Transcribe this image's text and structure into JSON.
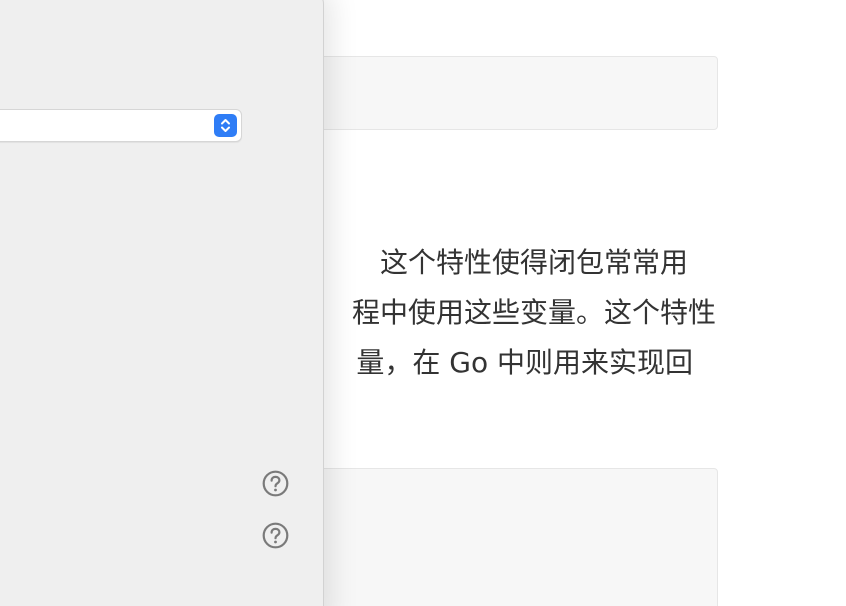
{
  "document": {
    "paragraph_lines": [
      "这个特性使得闭包常常用",
      "程中使用这些变量。这个特性",
      "量，在 Go 中则用来实现回"
    ]
  },
  "panel": {
    "select_value": ""
  },
  "icons": {
    "stepper": "up-down-chevron-icon",
    "help": "question-mark-circle-icon"
  },
  "colors": {
    "accent": "#2f7df6",
    "panel_bg": "#efefef",
    "text": "#333333"
  }
}
